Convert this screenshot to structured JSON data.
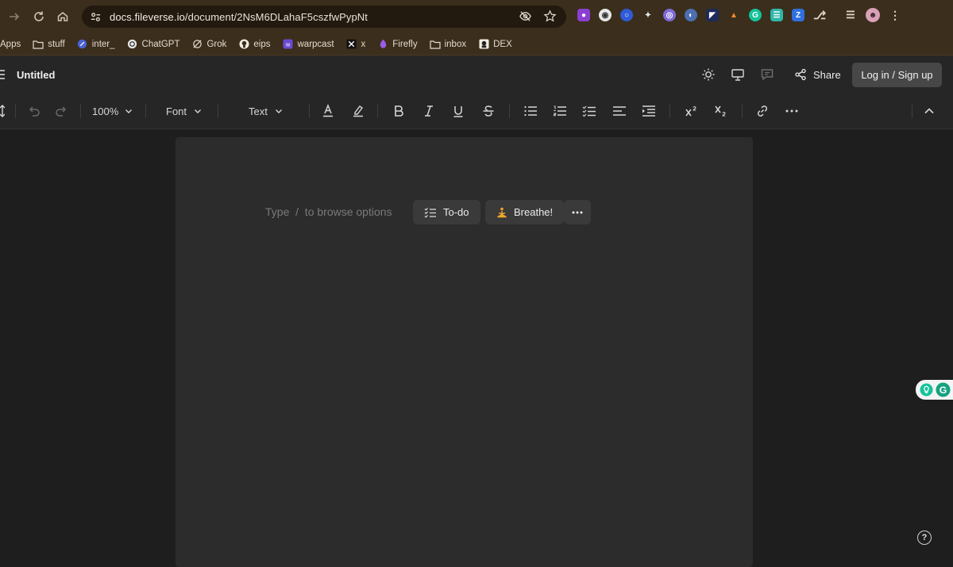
{
  "browser": {
    "url_host": "docs.fileverse.io",
    "url_path": "/document/2NsM6DLahaF5cszfwPypNt",
    "bookmarks": [
      {
        "label": "Apps",
        "icon": "grid-icon"
      },
      {
        "label": "stuff",
        "icon": "folder-icon"
      },
      {
        "label": "inter_",
        "icon": "link-icon"
      },
      {
        "label": "ChatGPT",
        "icon": "chatgpt-icon"
      },
      {
        "label": "Grok",
        "icon": "grok-icon"
      },
      {
        "label": "eips",
        "icon": "github-icon"
      },
      {
        "label": "warpcast",
        "icon": "warpcast-icon"
      },
      {
        "label": "x",
        "icon": "x-icon"
      },
      {
        "label": "Firefly",
        "icon": "firefly-icon"
      },
      {
        "label": "inbox",
        "icon": "folder-icon"
      },
      {
        "label": "DEX",
        "icon": "dex-icon"
      }
    ],
    "colors": {
      "chrome": "#3b2e1c",
      "omnibox": "#22190f"
    }
  },
  "app": {
    "doc_title": "Untitled",
    "share_label": "Share",
    "login_label": "Log in / Sign up"
  },
  "toolbar": {
    "zoom": "100%",
    "font_label": "Font",
    "text_style_label": "Text"
  },
  "editor": {
    "placeholder": "Type  /  to browse options",
    "chips": [
      {
        "label": "To-do",
        "icon": "checklist-icon"
      },
      {
        "label": "Breathe!",
        "icon": "meditation-icon"
      }
    ],
    "page_color": "#2c2c2c"
  },
  "help_label": "?"
}
